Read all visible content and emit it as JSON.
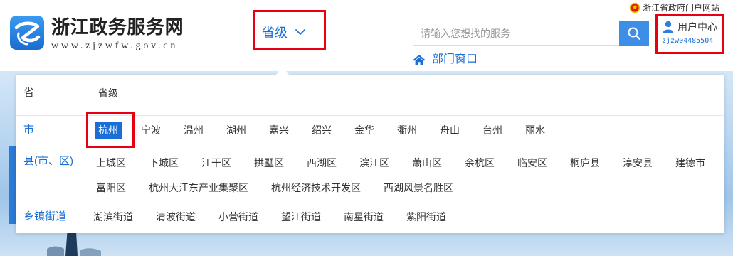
{
  "colors": {
    "accent": "#1a6fd6",
    "search_button": "#3d8ee6",
    "highlight": "#e60012",
    "text": "#333333"
  },
  "icons": {
    "logo": "site-logo",
    "region_toggle": "chevron-down-icon",
    "search": "search-icon",
    "user": "user-icon",
    "dept_window": "home-icon",
    "gov_portal": "national-emblem-icon"
  },
  "top_bar": {
    "gov_portal_link": "浙江省政府门户网站"
  },
  "header": {
    "site_title": "浙江政务服务网",
    "site_url": "www.zjzwfw.gov.cn",
    "region_selector_label": "省级",
    "search": {
      "placeholder": "请输入您想找的服务"
    },
    "dept_window_label": "部门窗口",
    "user_center": {
      "label": "用户中心",
      "username": "zjzw04485504"
    }
  },
  "region_panel": {
    "province": {
      "label": "省",
      "items": [
        "省级"
      ]
    },
    "city": {
      "label": "市",
      "selected_index": 0,
      "items": [
        "杭州",
        "宁波",
        "温州",
        "湖州",
        "嘉兴",
        "绍兴",
        "金华",
        "衢州",
        "舟山",
        "台州",
        "丽水"
      ]
    },
    "county": {
      "label": "县(市、区)",
      "items": [
        "上城区",
        "下城区",
        "江干区",
        "拱墅区",
        "西湖区",
        "滨江区",
        "萧山区",
        "余杭区",
        "临安区",
        "桐庐县",
        "淳安县",
        "建德市",
        "富阳区",
        "杭州大江东产业集聚区",
        "杭州经济技术开发区",
        "西湖风景名胜区"
      ]
    },
    "township": {
      "label": "乡镇街道",
      "items": [
        "湖滨街道",
        "清波街道",
        "小营街道",
        "望江街道",
        "南星街道",
        "紫阳街道"
      ]
    }
  }
}
